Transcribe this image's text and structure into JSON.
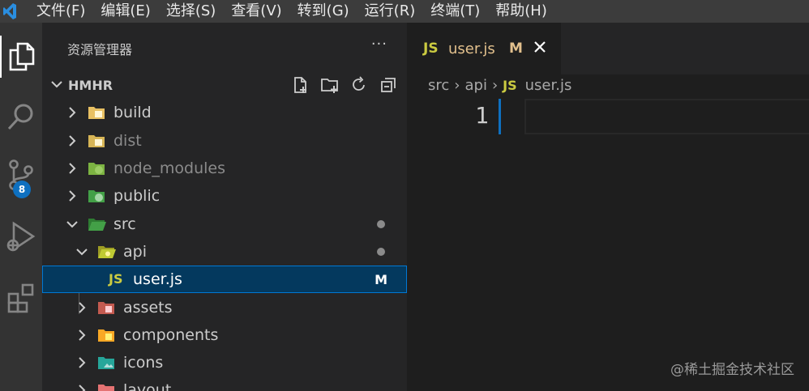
{
  "menu": [
    "文件(F)",
    "编辑(E)",
    "选择(S)",
    "查看(V)",
    "转到(G)",
    "运行(R)",
    "终端(T)",
    "帮助(H)"
  ],
  "activity_bar": {
    "items": [
      "explorer-icon",
      "search-icon",
      "source-control-icon",
      "run-debug-icon",
      "extensions-icon"
    ],
    "source_control_badge": "8"
  },
  "sidebar": {
    "title": "资源管理器",
    "more": "···",
    "folder": "HMHR",
    "folder_actions": [
      "new-file-icon",
      "new-folder-icon",
      "refresh-icon",
      "collapse-all-icon"
    ],
    "tree": [
      {
        "label": "build",
        "expanded": false,
        "icon": "folder-build-icon",
        "color": "#e8c063"
      },
      {
        "label": "dist",
        "expanded": false,
        "icon": "folder-dist-icon",
        "color": "#e8c063",
        "dim": true
      },
      {
        "label": "node_modules",
        "expanded": false,
        "icon": "folder-node-icon",
        "color": "#8bc34a",
        "dim": true
      },
      {
        "label": "public",
        "expanded": false,
        "icon": "folder-public-icon",
        "color": "#4caf50"
      },
      {
        "label": "src",
        "expanded": true,
        "icon": "folder-src-icon",
        "color": "#4caf50",
        "dot": true
      },
      {
        "label": "api",
        "expanded": true,
        "icon": "folder-api-icon",
        "color": "#c0ca33",
        "dot": true
      },
      {
        "label": "user.js",
        "file": true,
        "icon": "js-file-icon",
        "status": "M",
        "selected": true
      },
      {
        "label": "assets",
        "expanded": false,
        "icon": "folder-assets-icon",
        "color": "#e57373"
      },
      {
        "label": "components",
        "expanded": false,
        "icon": "folder-components-icon",
        "color": "#f9a825"
      },
      {
        "label": "icons",
        "expanded": false,
        "icon": "folder-images-icon",
        "color": "#26a69a"
      },
      {
        "label": "layout",
        "expanded": false,
        "icon": "folder-layout-icon",
        "color": "#e57373"
      }
    ]
  },
  "editor": {
    "tab": {
      "lang": "JS",
      "name": "user.js",
      "status": "M"
    },
    "breadcrumbs": [
      "src",
      "api",
      "user.js"
    ],
    "breadcrumb_lang": "JS",
    "line_number": "1"
  },
  "watermark": "@稀土掘金技术社区",
  "colors": {
    "accent": "#0e70c0",
    "modified": "#e2c08d",
    "js": "#cbcb41",
    "selection": "#04395e"
  }
}
